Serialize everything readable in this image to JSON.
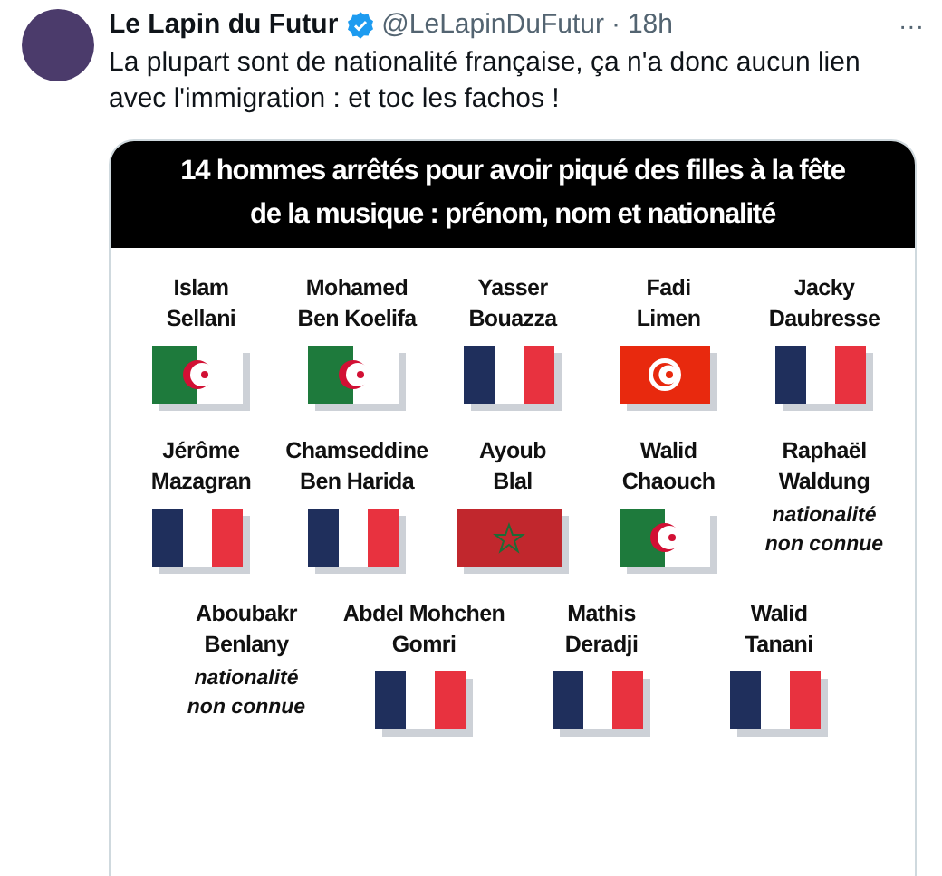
{
  "tweet": {
    "author": "Le Lapin du Futur",
    "verified": true,
    "handle": "@LeLapinDuFutur",
    "separator": "·",
    "time": "18h",
    "more": "···",
    "text": "La plupart sont de nationalité française, ça n'a donc aucun lien avec l'immigration : et toc les fachos !"
  },
  "graphic": {
    "title_lines": [
      "14 hommes arrêtés pour avoir piqué des filles à la fête",
      "de la musique : prénom, nom et nationalité"
    ],
    "lines": [
      {
        "people": [
          {
            "first": "Islam",
            "last": "Sellani",
            "kind": "algeria"
          },
          {
            "first": "Mohamed",
            "last": "Ben Koelifa",
            "kind": "algeria"
          },
          {
            "first": "Yasser",
            "last": "Bouazza",
            "kind": "france"
          },
          {
            "first": "Fadi",
            "last": "Limen",
            "kind": "tunisia"
          },
          {
            "first": "Jacky",
            "last": "Daubresse",
            "kind": "france"
          }
        ]
      },
      {
        "people": [
          {
            "first": "Jérôme",
            "last": "Mazagran",
            "kind": "france"
          },
          {
            "first": "Chamseddine",
            "last": "Ben Harida",
            "kind": "france"
          },
          {
            "first": "Ayoub",
            "last": "Blal",
            "kind": "morocco"
          },
          {
            "first": "Walid",
            "last": "Chaouch",
            "kind": "algeria"
          },
          {
            "first": "Raphaël",
            "last": "Waldung",
            "kind": "unknown",
            "note": [
              "nationalité",
              "non connue"
            ]
          }
        ]
      },
      {
        "people": [
          {
            "first": "Aboubakr",
            "last": "Benlany",
            "kind": "unknown",
            "note": [
              "nationalité",
              "non connue"
            ]
          },
          {
            "first": "Abdel Mohchen",
            "last": "Gomri",
            "kind": "france"
          },
          {
            "first": "Mathis",
            "last": "Deradji",
            "kind": "france"
          },
          {
            "first": "Walid",
            "last": "Tanani",
            "kind": "france"
          }
        ]
      }
    ]
  }
}
